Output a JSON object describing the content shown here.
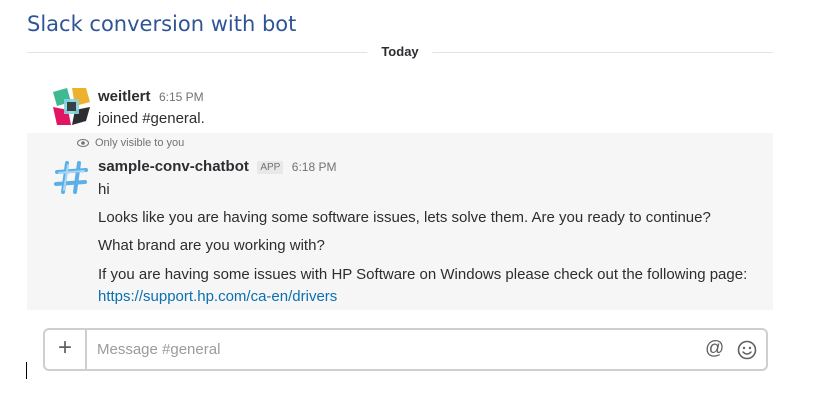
{
  "doc_title": "Slack conversion with bot",
  "day_divider": "Today",
  "messages": [
    {
      "author": "weitlert",
      "time": "6:15 PM",
      "lines": [
        "joined #general."
      ],
      "avatar_icon": "slack-logo-icon"
    },
    {
      "visibility_note": "Only visible to you",
      "author": "sample-conv-chatbot",
      "badge": "APP",
      "time": "6:18 PM",
      "avatar_icon": "bot-hash-icon",
      "lines": [
        "hi",
        "Looks like you are having some software issues, lets solve them. Are you ready to continue?",
        "What brand are you working with?",
        "If you are having some issues with HP Software on Windows please check out the following page:"
      ],
      "link": "https://support.hp.com/ca-en/drivers"
    }
  ],
  "composer": {
    "placeholder": "Message #general",
    "plus_label": "+",
    "at_label": "@"
  },
  "colors": {
    "title": "#2f5597",
    "link": "#0b6fb0",
    "highlight_bg": "#f6f6f6"
  }
}
